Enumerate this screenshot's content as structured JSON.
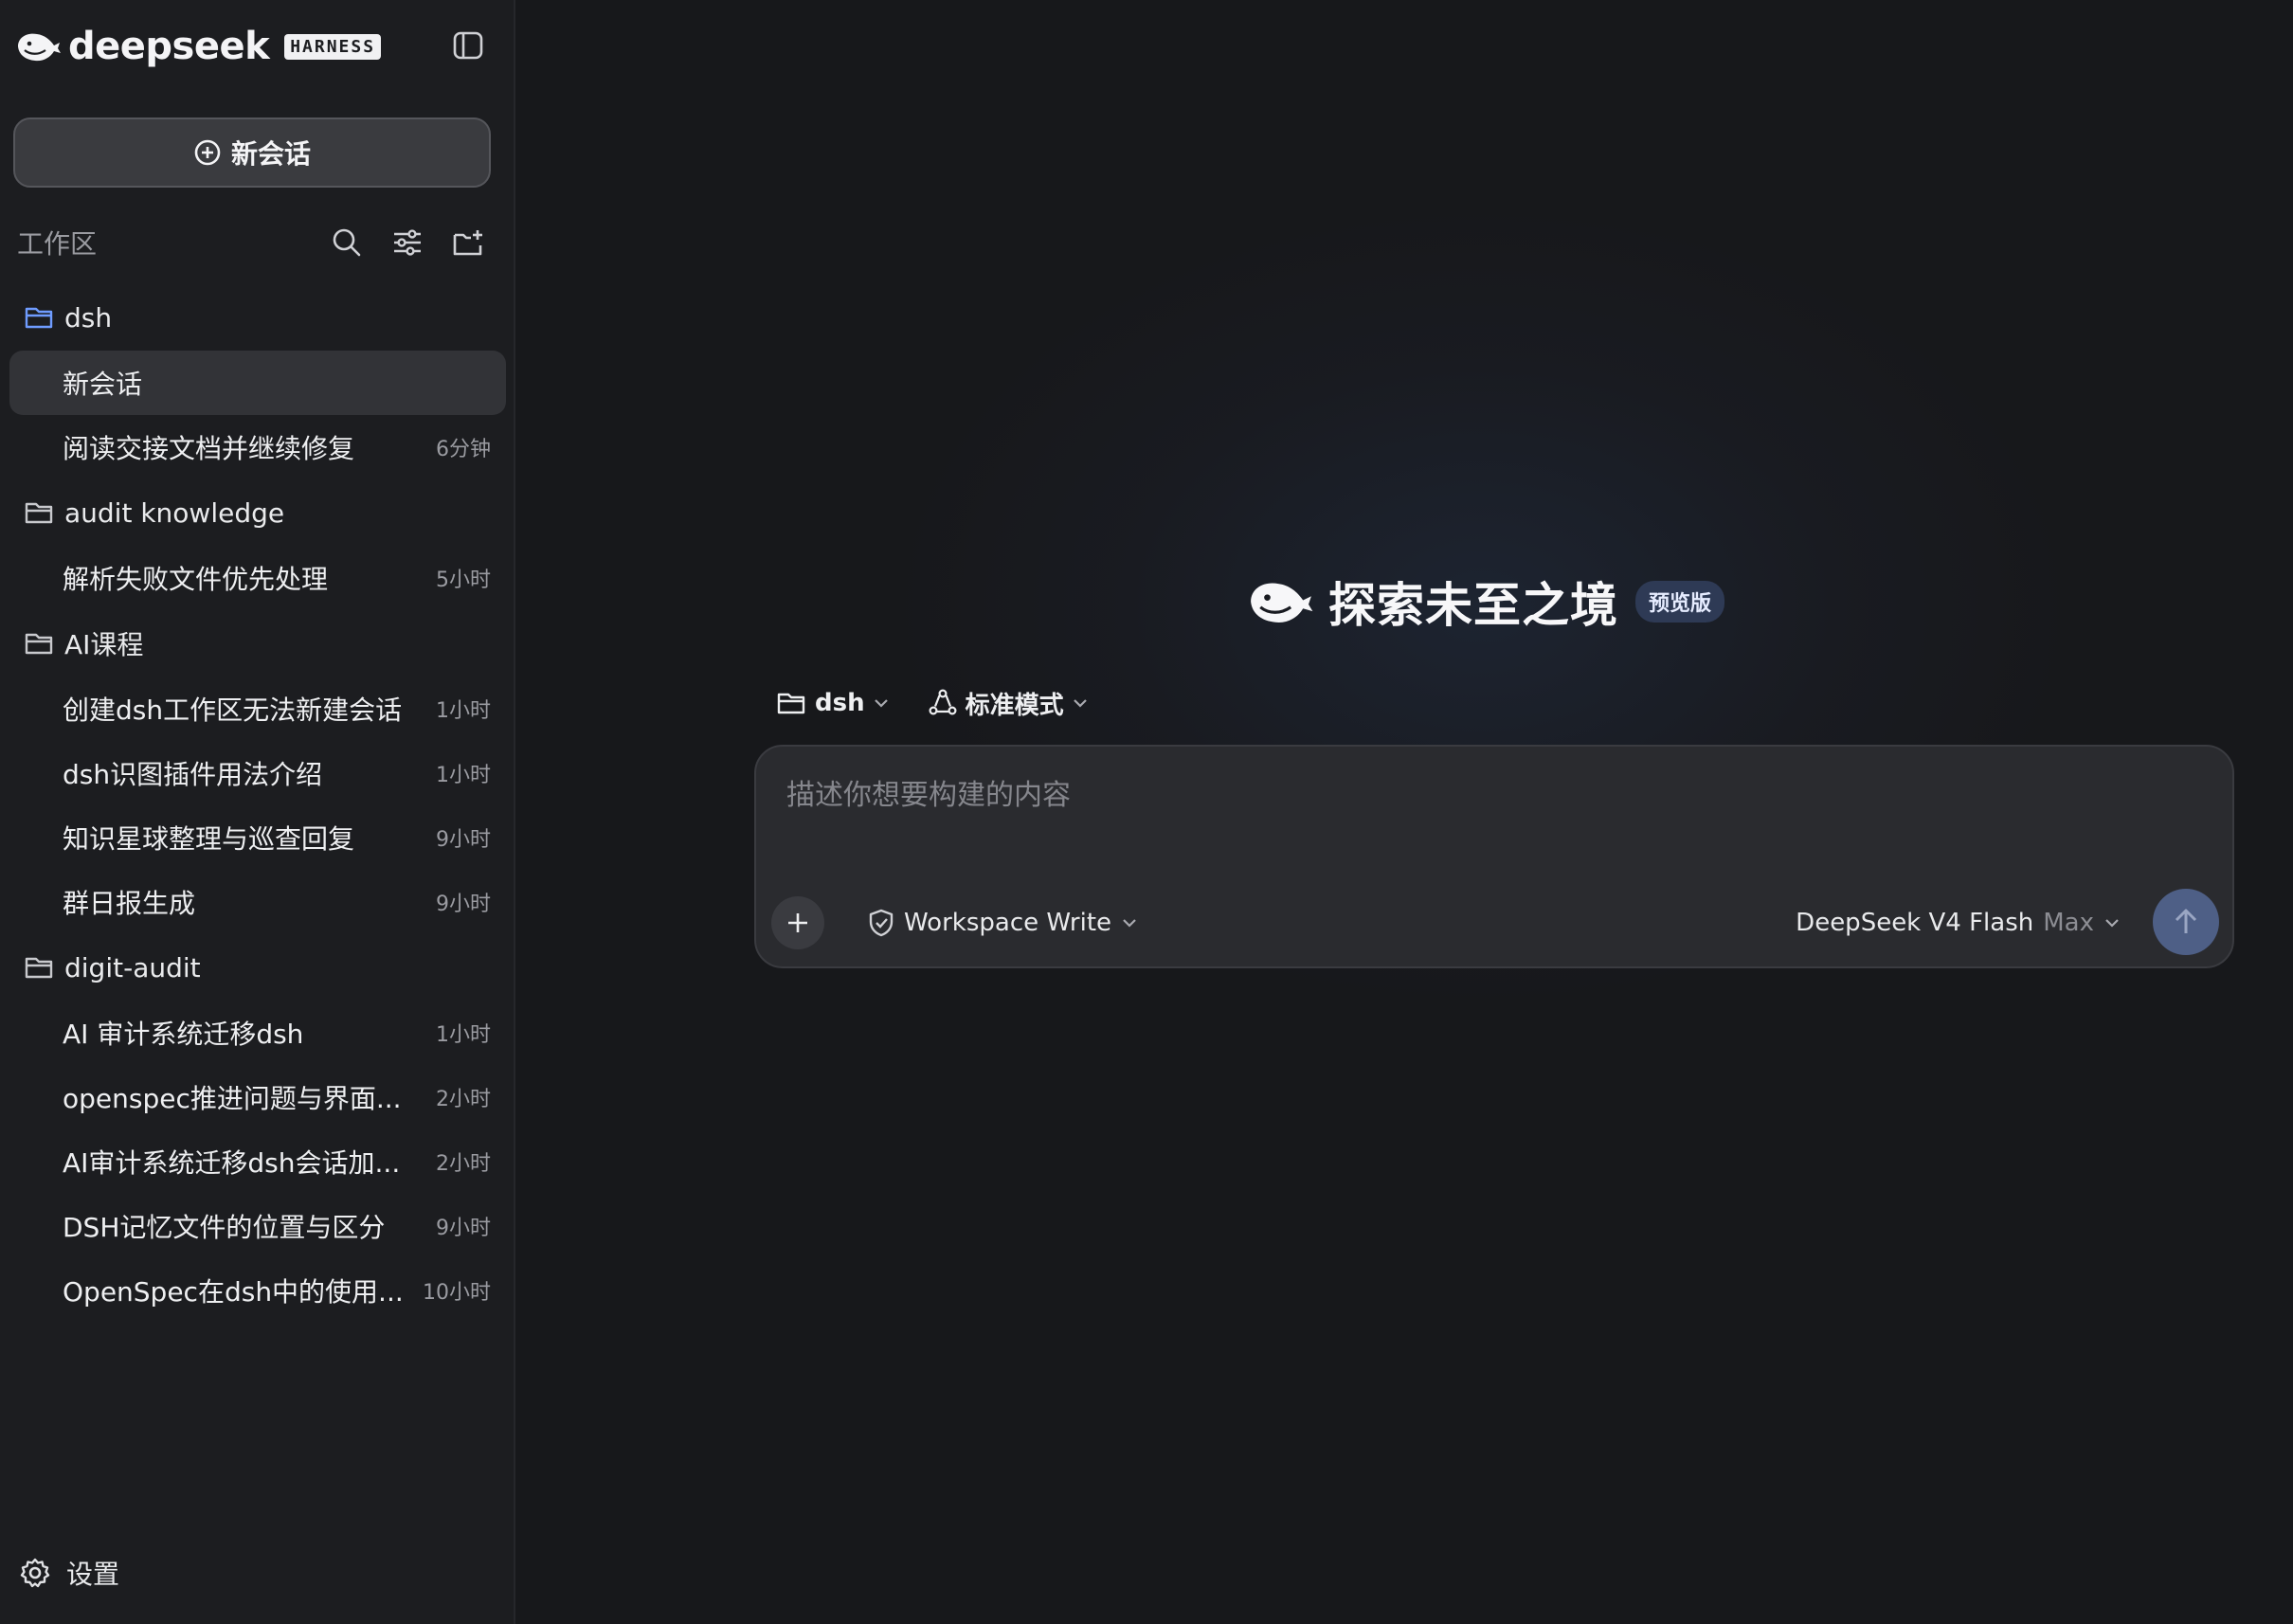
{
  "app": {
    "logo_text": "deepseek",
    "badge": "HARNESS"
  },
  "sidebar": {
    "new_chat_label": "新会话",
    "workspace_title": "工作区",
    "settings_label": "设置",
    "folders": [
      {
        "name": "dsh",
        "active_color": "#6f9cff",
        "sessions": [
          {
            "title": "新会话",
            "time": "",
            "active": true
          },
          {
            "title": "阅读交接文档并继续修复",
            "time": "6分钟",
            "active": false
          }
        ]
      },
      {
        "name": "audit knowledge",
        "sessions": [
          {
            "title": "解析失败文件优先处理",
            "time": "5小时"
          }
        ]
      },
      {
        "name": "AI课程",
        "sessions": [
          {
            "title": "创建dsh工作区无法新建会话",
            "time": "1小时"
          },
          {
            "title": "dsh识图插件用法介绍",
            "time": "1小时"
          },
          {
            "title": "知识星球整理与巡查回复",
            "time": "9小时"
          },
          {
            "title": "群日报生成",
            "time": "9小时"
          }
        ]
      },
      {
        "name": "digit-audit",
        "sessions": [
          {
            "title": "AI 审计系统迁移dsh",
            "time": "1小时"
          },
          {
            "title": "openspec推进问题与界面...",
            "time": "2小时"
          },
          {
            "title": "AI审计系统迁移dsh会话加...",
            "time": "2小时"
          },
          {
            "title": "DSH记忆文件的位置与区分",
            "time": "9小时"
          },
          {
            "title": "OpenSpec在dsh中的使用...",
            "time": "10小时"
          }
        ]
      }
    ]
  },
  "main": {
    "hero_title": "探索未至之境",
    "hero_badge": "预览版",
    "workspace_selector": "dsh",
    "mode_selector": "标准模式",
    "composer": {
      "placeholder": "描述你想要构建的内容",
      "value": "",
      "permission": "Workspace Write",
      "model_name": "DeepSeek V4 Flash",
      "model_tier": "Max"
    }
  },
  "colors": {
    "accent": "#4e5f86",
    "folder_active": "#6f9cff",
    "sidebar_bg": "#1c1d20",
    "main_bg": "#17181b"
  }
}
